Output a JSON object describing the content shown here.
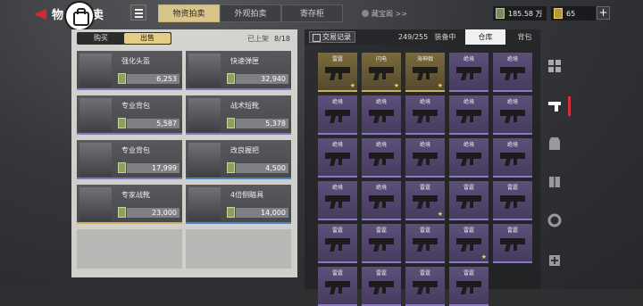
{
  "header": {
    "title": "物资拍卖",
    "tabs": [
      {
        "label": "物资拍卖",
        "active": true
      },
      {
        "label": "外观拍卖",
        "active": false
      },
      {
        "label": "寄存柜",
        "active": false
      }
    ],
    "treasure_link": "藏宝阁 >>",
    "currency1": "185.58 万",
    "currency2": "65",
    "plus": "+"
  },
  "left": {
    "buy_label": "购买",
    "sell_label": "出售",
    "listed_label": "已上架",
    "listed_count": "8/18",
    "slots": [
      {
        "name": "强化头盔",
        "price": "6,253",
        "rarity": "purple",
        "icon": "helmet-icon"
      },
      {
        "name": "快速弹匣",
        "price": "32,940",
        "rarity": "purple",
        "icon": "magazine-icon"
      },
      {
        "name": "专业背包",
        "price": "5,587",
        "rarity": "purple",
        "icon": "backpack-icon"
      },
      {
        "name": "战术短靴",
        "price": "5,378",
        "rarity": "purple",
        "icon": "boots-icon"
      },
      {
        "name": "专业背包",
        "price": "17,999",
        "rarity": "purple",
        "icon": "backpack-icon"
      },
      {
        "name": "改良握把",
        "price": "4,500",
        "rarity": "blue",
        "icon": "grip-icon"
      },
      {
        "name": "专家战靴",
        "price": "23,000",
        "rarity": "gold",
        "icon": "combat-boots-icon"
      },
      {
        "name": "4倍侧瞄具",
        "price": "14,000",
        "rarity": "blue",
        "icon": "scope-icon"
      }
    ]
  },
  "right": {
    "trade_label": "交易记录",
    "capacity": "249/255",
    "tabs": [
      {
        "label": "装备中",
        "active": false
      },
      {
        "label": "仓库",
        "active": true
      },
      {
        "label": "背包",
        "active": false
      }
    ],
    "grid": [
      {
        "name": "雷霆",
        "rarity": "gold",
        "star": true
      },
      {
        "name": "闪电",
        "rarity": "gold",
        "star": true
      },
      {
        "name": "海神戟",
        "rarity": "gold",
        "star": true
      },
      {
        "name": "绝境",
        "rarity": "purple",
        "star": false
      },
      {
        "name": "绝境",
        "rarity": "purple",
        "star": false
      },
      {
        "name": "绝境",
        "rarity": "purple",
        "star": false
      },
      {
        "name": "绝境",
        "rarity": "purple",
        "star": false
      },
      {
        "name": "绝境",
        "rarity": "purple",
        "star": false
      },
      {
        "name": "绝境",
        "rarity": "purple",
        "star": false
      },
      {
        "name": "绝境",
        "rarity": "purple",
        "star": false
      },
      {
        "name": "绝境",
        "rarity": "purple",
        "star": false
      },
      {
        "name": "绝境",
        "rarity": "purple",
        "star": false
      },
      {
        "name": "绝境",
        "rarity": "purple",
        "star": false
      },
      {
        "name": "绝境",
        "rarity": "purple",
        "star": false
      },
      {
        "name": "绝境",
        "rarity": "purple",
        "star": false
      },
      {
        "name": "绝境",
        "rarity": "purple",
        "star": false
      },
      {
        "name": "绝境",
        "rarity": "purple",
        "star": false
      },
      {
        "name": "雷霆",
        "rarity": "purple",
        "star": true
      },
      {
        "name": "雷霆",
        "rarity": "purple",
        "star": false
      },
      {
        "name": "雷霆",
        "rarity": "purple",
        "star": false
      },
      {
        "name": "雷霆",
        "rarity": "purple",
        "star": false
      },
      {
        "name": "雷霆",
        "rarity": "purple",
        "star": false
      },
      {
        "name": "雷霆",
        "rarity": "purple",
        "star": false
      },
      {
        "name": "雷霆",
        "rarity": "purple",
        "star": true
      },
      {
        "name": "雷霆",
        "rarity": "purple",
        "star": false
      },
      {
        "name": "雷霆",
        "rarity": "purple",
        "star": false
      },
      {
        "name": "雷霆",
        "rarity": "purple",
        "star": false
      },
      {
        "name": "雷霆",
        "rarity": "purple",
        "star": false
      },
      {
        "name": "雷霆",
        "rarity": "purple",
        "star": false
      }
    ],
    "side_icons": [
      "grid-icon",
      "pistol-icon",
      "vest-icon",
      "armor-icon",
      "gear-icon",
      "medkit-icon"
    ]
  },
  "colors": {
    "gold": "#cdb05d",
    "purple": "#8b77bf",
    "accent_red": "#d02a35"
  }
}
